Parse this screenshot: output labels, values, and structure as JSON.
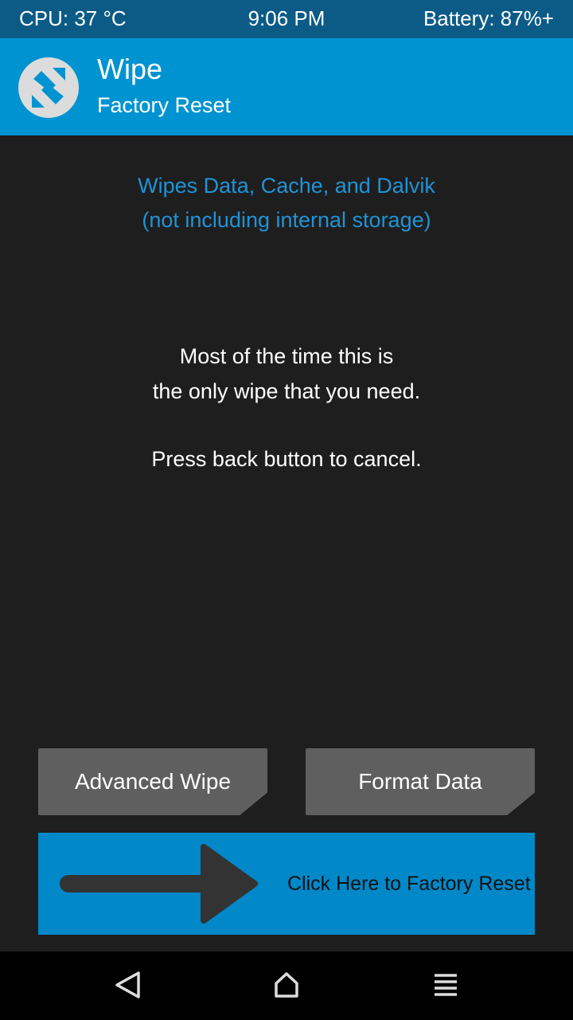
{
  "statusbar": {
    "cpu": "CPU: 37 °C",
    "time": "9:06 PM",
    "battery": "Battery: 87%+"
  },
  "header": {
    "title": "Wipe",
    "subtitle": "Factory Reset",
    "logo_icon": "twrp-logo-icon"
  },
  "info": {
    "blue_line1": "Wipes Data, Cache, and Dalvik",
    "blue_line2": "(not including internal storage)",
    "white_line1": "Most of the time this is",
    "white_line2": "the only wipe that you need.",
    "white_line3": "Press back button to cancel."
  },
  "buttons": {
    "advanced_wipe": "Advanced Wipe",
    "format_data": "Format Data"
  },
  "slider": {
    "label": "Click Here to Factory Reset",
    "icon": "arrow-right-icon"
  },
  "navbar": {
    "back_icon": "back-triangle-icon",
    "home_icon": "home-icon",
    "menu_icon": "menu-icon"
  },
  "colors": {
    "statusbar": "#0c5b86",
    "header": "#0093d1",
    "background": "#1e1e1e",
    "accent_text": "#1f93d6",
    "button": "#5f5f5f",
    "slider": "#0088c9"
  }
}
